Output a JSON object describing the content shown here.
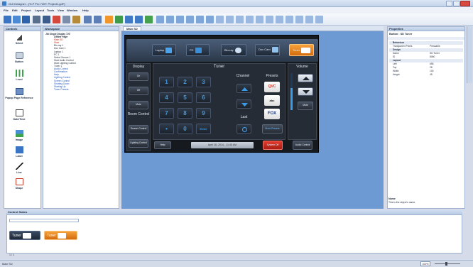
{
  "window": {
    "title": "GUI Designer - [TLP Pro 720T: Project1.gdf*]"
  },
  "menu": [
    "File",
    "Edit",
    "Project",
    "Layout",
    "Tools",
    "View",
    "Window",
    "Help"
  ],
  "controls_panel": {
    "title": "Controls",
    "items": [
      "Select",
      "Button",
      "Level",
      "Popup Page Reference",
      "Date/Time",
      "Image",
      "Label",
      "Line",
      "Shape"
    ]
  },
  "workspace_panel": {
    "title": "Workspace",
    "root": "Jkt Single Display 720",
    "items": [
      "Offline Page",
      "Main SD",
      "Start",
      "Blu-ray 1",
      "Doc Cam 1",
      "Laptop 1",
      "PC 1",
      "Select Source 1",
      "Start Audio Control",
      "Start Lighting Control",
      "Tuner 1",
      "Audio Control",
      "Confirmation",
      "Help",
      "Lighting Control",
      "Screen Control",
      "Shutting Down",
      "Starting Up",
      "Tuner Presets"
    ]
  },
  "canvas_tab": "Main SD",
  "touch_ui": {
    "sources": [
      "Laptop",
      "PC",
      "Blu-ray",
      "Doc Cam",
      "Tuner"
    ],
    "display_label": "Display",
    "display_buttons": [
      "On",
      "Off",
      "Mute"
    ],
    "room_control_label": "Room Control",
    "screen_control": "Screen Control",
    "lighting_control": "Lighting Control",
    "help": "Help",
    "tuner_title": "Tuner",
    "keypad": [
      "1",
      "2",
      "3",
      "4",
      "5",
      "6",
      "7",
      "8",
      "9",
      "•",
      "0",
      "Enter"
    ],
    "channel_label": "Channel",
    "last_label": "Last",
    "presets_label": "Presets",
    "presets": [
      "QVC",
      "abc",
      "FOX"
    ],
    "more_presets": "More Presets",
    "volume_label": "Volume",
    "mute": "Mute",
    "audio_control": "Audio Control",
    "system_off": "System Off",
    "datetime": "April 28, 2014 - 11:45 AM"
  },
  "properties": {
    "title": "Properties",
    "object": "Button : SD Tuner",
    "sections": [
      {
        "name": "Behaviour",
        "rows": [
          [
            "Transparent Pixels",
            "Pressable"
          ]
        ]
      },
      {
        "name": "Design",
        "rows": [
          [
            "Name",
            "SD Tuner"
          ],
          [
            "ID",
            "8060"
          ]
        ]
      },
      {
        "name": "Layout",
        "rows": [
          [
            "Left",
            "655"
          ],
          [
            "Top",
            "28"
          ],
          [
            "Width",
            "100"
          ],
          [
            "Height",
            "45"
          ]
        ]
      }
    ],
    "desc_title": "Name",
    "desc_text": "This is the object's name."
  },
  "control_states": {
    "title": "Control States",
    "label": "Tuner"
  },
  "status": {
    "left": "Main SD",
    "zoom": "100%",
    "nav": "1 / 1"
  },
  "colors": {
    "accent": "#f0962a",
    "keypad_text": "#3b9be8",
    "canvas_bg": "#6d9ad2"
  }
}
